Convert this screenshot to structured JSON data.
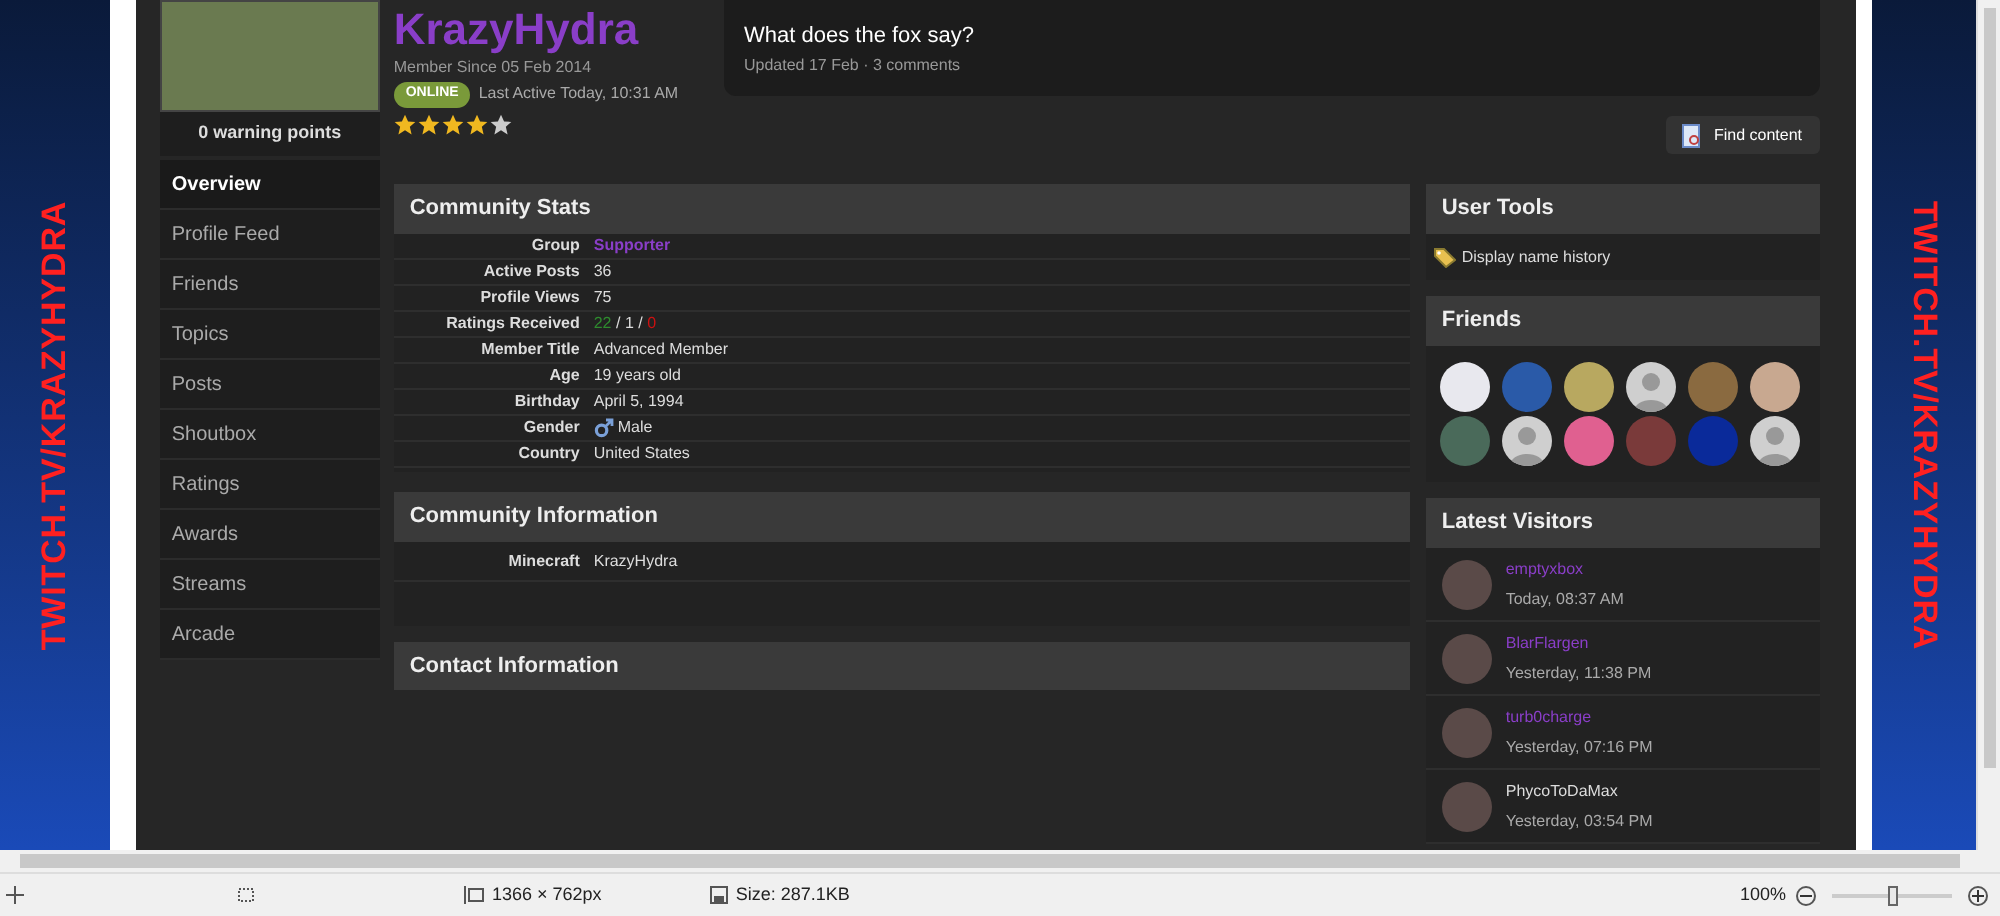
{
  "banner_left": {
    "text": "TWITCH.TV/KRAZYHYDRA"
  },
  "banner_right": {
    "text": "TWITCH.TV/KRAZYHYDRA"
  },
  "profile": {
    "warning_points": "0 warning points",
    "name": "KrazyHydra",
    "member_since": "Member Since 05 Feb 2014",
    "online_badge": "ONLINE",
    "last_active": "Last Active Today, 10:31 AM",
    "stars": 4
  },
  "status_update": {
    "text": "What does the fox say?",
    "meta": "Updated 17 Feb · 3 comments"
  },
  "find_content_button": "Find content",
  "sidebar": {
    "items": [
      {
        "label": "Overview",
        "selected": true
      },
      {
        "label": "Profile Feed",
        "selected": false
      },
      {
        "label": "Friends",
        "selected": false
      },
      {
        "label": "Topics",
        "selected": false
      },
      {
        "label": "Posts",
        "selected": false
      },
      {
        "label": "Shoutbox",
        "selected": false
      },
      {
        "label": "Ratings",
        "selected": false
      },
      {
        "label": "Awards",
        "selected": false
      },
      {
        "label": "Streams",
        "selected": false
      },
      {
        "label": "Arcade",
        "selected": false
      }
    ]
  },
  "community_stats": {
    "title": "Community Stats",
    "rows": [
      {
        "kind": "link",
        "label": "Group",
        "value": "Supporter"
      },
      {
        "kind": "text",
        "label": "Active Posts",
        "value": "36"
      },
      {
        "kind": "text",
        "label": "Profile Views",
        "value": "75"
      },
      {
        "kind": "ratings",
        "label": "Ratings Received",
        "parts": [
          {
            "text": "22",
            "color": "#2e8b2e"
          },
          {
            "text": " / ",
            "color": "#dddddd"
          },
          {
            "text": "1",
            "color": "#dddddd"
          },
          {
            "text": " / ",
            "color": "#dddddd"
          },
          {
            "text": "0",
            "color": "#cc1111"
          }
        ]
      },
      {
        "kind": "text",
        "label": "Member Title",
        "value": "Advanced Member"
      },
      {
        "kind": "text",
        "label": "Age",
        "value": "19 years old"
      },
      {
        "kind": "text",
        "label": "Birthday",
        "value": "April 5, 1994"
      },
      {
        "kind": "gender",
        "label": "Gender",
        "value": "Male"
      },
      {
        "kind": "text",
        "label": "Country",
        "value": "United States"
      }
    ]
  },
  "community_information": {
    "title": "Community Information",
    "rows": [
      {
        "kind": "text",
        "label": "Minecraft",
        "value": "KrazyHydra"
      }
    ]
  },
  "contact_information": {
    "title": "Contact Information"
  },
  "user_tools": {
    "title": "User Tools",
    "items": [
      "Display name history"
    ]
  },
  "friends": {
    "title": "Friends",
    "avatars": [
      {
        "kind": "photo",
        "color": "#e8e8ee"
      },
      {
        "kind": "photo",
        "color": "#2a5aa8"
      },
      {
        "kind": "photo",
        "color": "#b8a860"
      },
      {
        "kind": "default",
        "color": "#cfcfcf"
      },
      {
        "kind": "photo",
        "color": "#8a6a40"
      },
      {
        "kind": "photo",
        "color": "#c8a890"
      },
      {
        "kind": "photo",
        "color": "#4a6a5a"
      },
      {
        "kind": "default",
        "color": "#cfcfcf"
      },
      {
        "kind": "photo",
        "color": "#e06090"
      },
      {
        "kind": "photo",
        "color": "#7a3a3a"
      },
      {
        "kind": "photo",
        "color": "#0a2a9a"
      },
      {
        "kind": "default",
        "color": "#cfcfcf"
      }
    ]
  },
  "latest_visitors": {
    "title": "Latest Visitors",
    "items": [
      {
        "name": "emptyxbox",
        "time": "Today, 08:37 AM",
        "color": "#8a3ec8"
      },
      {
        "name": "BlarFlargen",
        "time": "Yesterday, 11:38 PM",
        "color": "#8a3ec8"
      },
      {
        "name": "turb0charge",
        "time": "Yesterday, 07:16 PM",
        "color": "#8a3ec8"
      },
      {
        "name": "PhycoToDaMax",
        "time": "Yesterday, 03:54 PM",
        "color": "#dddddd"
      }
    ]
  },
  "status_bar": {
    "dimensions": "1366 × 762px",
    "size": "Size: 287.1KB",
    "zoom": "100%",
    "zoom_slider": {
      "level": 0.5
    }
  }
}
